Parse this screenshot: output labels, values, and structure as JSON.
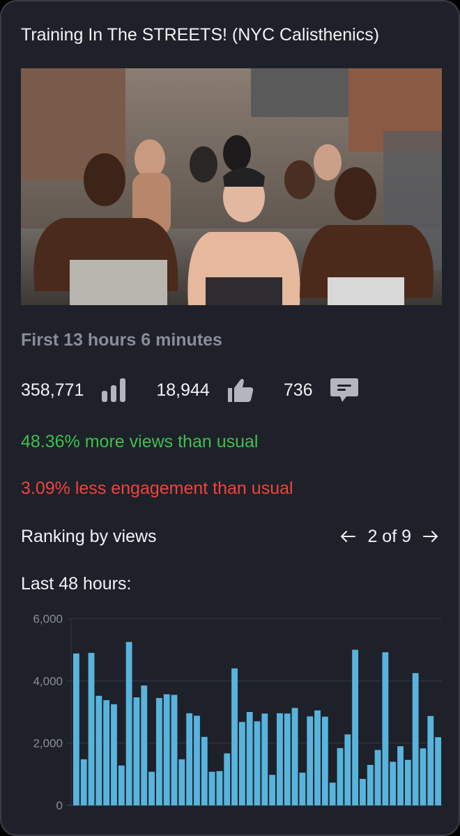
{
  "video": {
    "title": "Training In The STREETS! (NYC Calisthenics)"
  },
  "period_label": "First 13 hours 6 minutes",
  "stats": {
    "views": "358,771",
    "views_icon": "bar-chart-icon",
    "likes": "18,944",
    "likes_icon": "thumbs-up-icon",
    "comments": "736",
    "comments_icon": "comment-icon"
  },
  "comparison": {
    "views_text": "48.36% more views than usual",
    "views_color": "#3fbf4f",
    "engagement_text": "3.09% less engagement than usual",
    "engagement_color": "#f0433f"
  },
  "ranking": {
    "label": "Ranking by views",
    "position": "2 of 9",
    "prev_icon": "arrow-left-icon",
    "next_icon": "arrow-right-icon"
  },
  "chart_label": "Last 48 hours:",
  "chart_data": {
    "type": "bar",
    "xlabel": "",
    "ylabel": "",
    "ylim": [
      0,
      6000
    ],
    "yticks": [
      "0",
      "2,000",
      "4,000",
      "6,000"
    ],
    "grid": true,
    "color": "#58b4dd",
    "values": [
      4880,
      1480,
      4900,
      3520,
      3380,
      3250,
      1280,
      5250,
      3470,
      3850,
      1080,
      3450,
      3570,
      3550,
      1480,
      2960,
      2880,
      2200,
      1080,
      1100,
      1670,
      4400,
      2680,
      3000,
      2700,
      2950,
      980,
      2960,
      2950,
      3130,
      1050,
      2860,
      3050,
      2850,
      730,
      1840,
      2280,
      5000,
      850,
      1300,
      1780,
      4920,
      1400,
      1900,
      1460,
      4250,
      1830,
      2870,
      2190
    ]
  }
}
